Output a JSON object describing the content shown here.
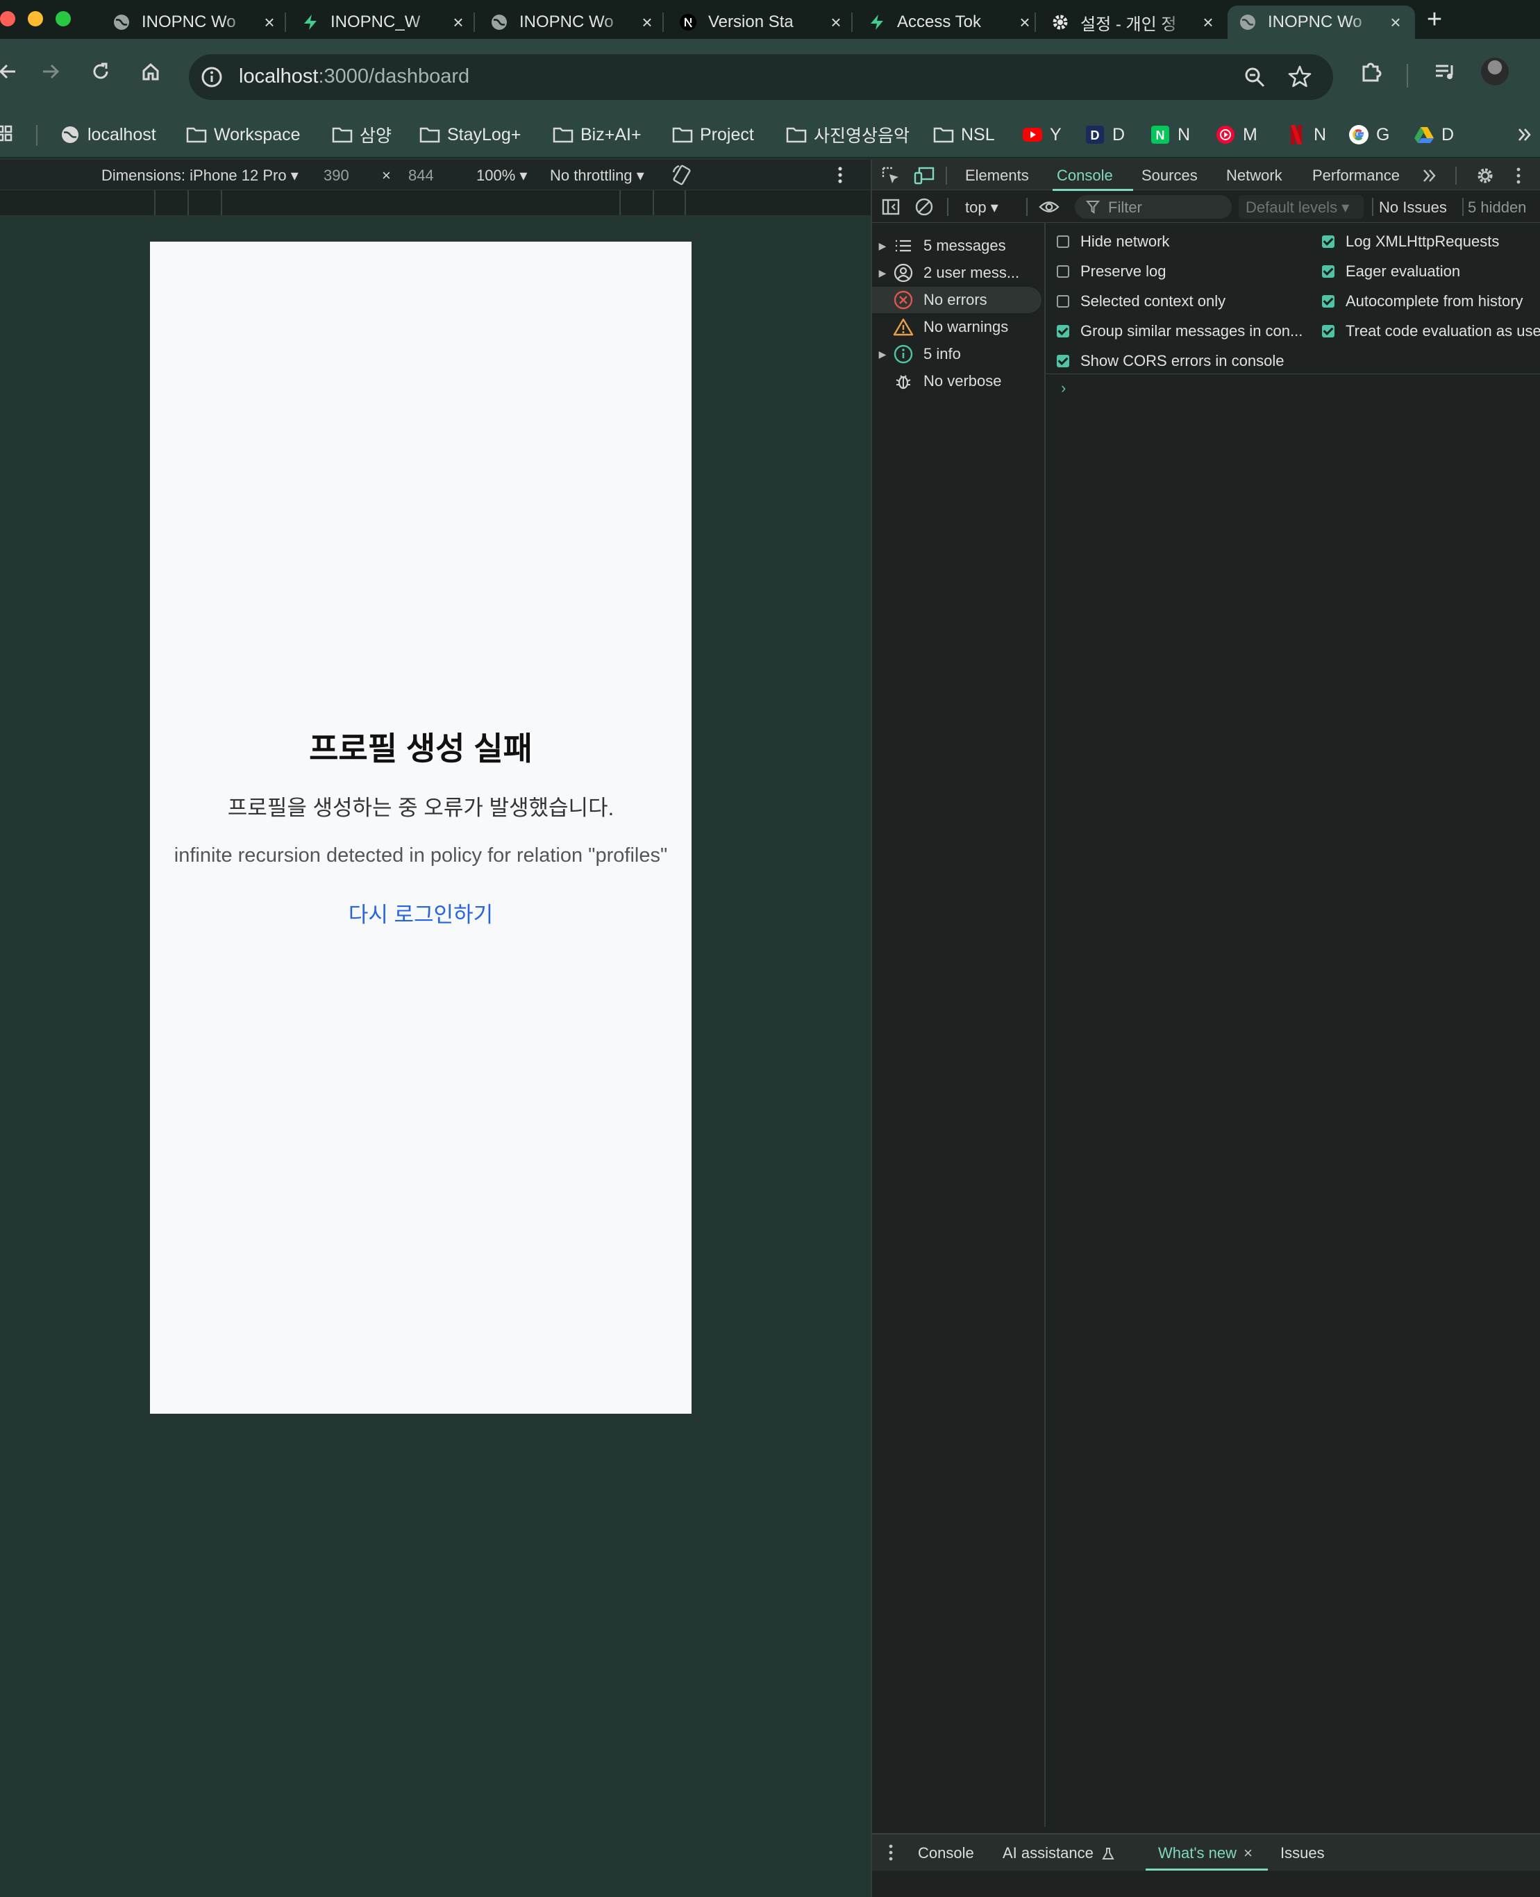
{
  "browser": {
    "tabs": [
      {
        "title": "INOPNC Wo",
        "favicon": "globe-icon",
        "active": false
      },
      {
        "title": "INOPNC_W",
        "favicon": "supabase-icon",
        "active": false
      },
      {
        "title": "INOPNC Wo",
        "favicon": "globe-icon",
        "active": false
      },
      {
        "title": "Version Sta",
        "favicon": "nextjs-icon",
        "active": false
      },
      {
        "title": "Access Tok",
        "favicon": "supabase-icon",
        "active": false
      },
      {
        "title": "설정 - 개인 정",
        "favicon": "gear-icon",
        "active": false
      },
      {
        "title": "INOPNC Wo",
        "favicon": "globe-icon",
        "active": true
      }
    ],
    "close_glyph": "×",
    "new_tab_glyph": "+",
    "url_host": "localhost",
    "url_rest": ":3000/dashboard",
    "bookmarks": [
      {
        "label": "localhost",
        "icon": "globe-icon"
      },
      {
        "label": "Workspace",
        "icon": "folder-icon"
      },
      {
        "label": "삼양",
        "icon": "folder-icon"
      },
      {
        "label": "StayLog+",
        "icon": "folder-icon"
      },
      {
        "label": "Biz+AI+",
        "icon": "folder-icon"
      },
      {
        "label": "Project",
        "icon": "folder-icon"
      },
      {
        "label": "사진영상음악",
        "icon": "folder-icon"
      },
      {
        "label": "NSL",
        "icon": "folder-icon"
      },
      {
        "label": "Y",
        "icon": "youtube-icon"
      },
      {
        "label": "D",
        "icon": "d-icon"
      },
      {
        "label": "N",
        "icon": "naver-icon"
      },
      {
        "label": "M",
        "icon": "music-icon"
      },
      {
        "label": "N",
        "icon": "netflix-icon"
      },
      {
        "label": "G",
        "icon": "google-icon"
      },
      {
        "label": "D",
        "icon": "drive-icon"
      }
    ]
  },
  "device_toolbar": {
    "dimensions_label": "Dimensions: iPhone 12 Pro",
    "width": "390",
    "times": "×",
    "height": "844",
    "zoom": "100%",
    "throttling": "No throttling"
  },
  "page": {
    "title": "프로필 생성 실패",
    "message": "프로필을 생성하는 중 오류가 발생했습니다.",
    "detail": "infinite recursion detected in policy for relation \"profiles\"",
    "link": "다시 로그인하기"
  },
  "devtools": {
    "tabs": [
      "Elements",
      "Console",
      "Sources",
      "Network",
      "Performance"
    ],
    "active_tab": "Console",
    "context": "top",
    "filter_placeholder": "Filter",
    "levels": "Default levels",
    "issues": "No Issues",
    "hidden": "5 hidden",
    "sidebar": [
      {
        "label": "5 messages",
        "icon": "list-icon",
        "expandable": true
      },
      {
        "label": "2 user mess...",
        "icon": "user-icon",
        "expandable": true
      },
      {
        "label": "No errors",
        "icon": "error-icon",
        "expandable": false,
        "selected": true
      },
      {
        "label": "No warnings",
        "icon": "warning-icon",
        "expandable": false
      },
      {
        "label": "5 info",
        "icon": "info-icon",
        "expandable": true
      },
      {
        "label": "No verbose",
        "icon": "bug-icon",
        "expandable": false
      }
    ],
    "settings_left": [
      {
        "label": "Hide network",
        "checked": false
      },
      {
        "label": "Preserve log",
        "checked": false
      },
      {
        "label": "Selected context only",
        "checked": false
      },
      {
        "label": "Group similar messages in con...",
        "checked": true
      },
      {
        "label": "Show CORS errors in console",
        "checked": true
      }
    ],
    "settings_right": [
      {
        "label": "Log XMLHttpRequests",
        "checked": true
      },
      {
        "label": "Eager evaluation",
        "checked": true
      },
      {
        "label": "Autocomplete from history",
        "checked": true
      },
      {
        "label": "Treat code evaluation as use",
        "checked": true
      }
    ],
    "prompt": "›",
    "drawer_tabs": [
      "Console",
      "AI assistance",
      "What's new",
      "Issues"
    ],
    "drawer_active": "What's new"
  },
  "colors": {
    "accent": "#7fd8c0",
    "link": "#2563eb",
    "error": "#e0564a",
    "warning": "#e8a14a",
    "info": "#4fc3a5"
  }
}
